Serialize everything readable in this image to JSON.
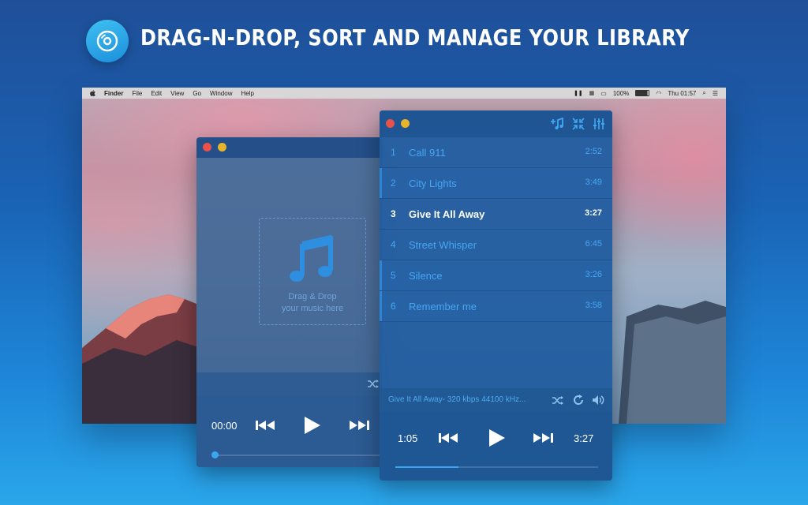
{
  "header": {
    "title": "Drag-n-Drop, Sort and Manage Your Library",
    "badge_icon": "disc-icon"
  },
  "menubar": {
    "items": [
      "Finder",
      "File",
      "Edit",
      "View",
      "Go",
      "Window",
      "Help"
    ],
    "battery": "100%",
    "clock": "Thu 01:57"
  },
  "drop_zone": {
    "line1": "Drag & Drop",
    "line2": "your music here",
    "icon": "music-note-icon"
  },
  "left_player": {
    "elapsed": "00:00",
    "progress": 0
  },
  "tracks": [
    {
      "num": "1",
      "title": "Call 911",
      "duration": "2:52"
    },
    {
      "num": "2",
      "title": "City Lights",
      "duration": "3:49"
    },
    {
      "num": "3",
      "title": "Give It All Away",
      "duration": "3:27"
    },
    {
      "num": "4",
      "title": "Street Whisper",
      "duration": "6:45"
    },
    {
      "num": "5",
      "title": "Silence",
      "duration": "3:26"
    },
    {
      "num": "6",
      "title": "Remember me",
      "duration": "3:58"
    }
  ],
  "now_playing": {
    "info": "Give It All Away- 320 kbps 44100 kHz...",
    "elapsed": "1:05",
    "total": "3:27",
    "progress": 0.31
  },
  "colors": {
    "accent": "#46a6f0",
    "background_top": "#1f4f98",
    "background_bottom": "#2aa6ea"
  }
}
